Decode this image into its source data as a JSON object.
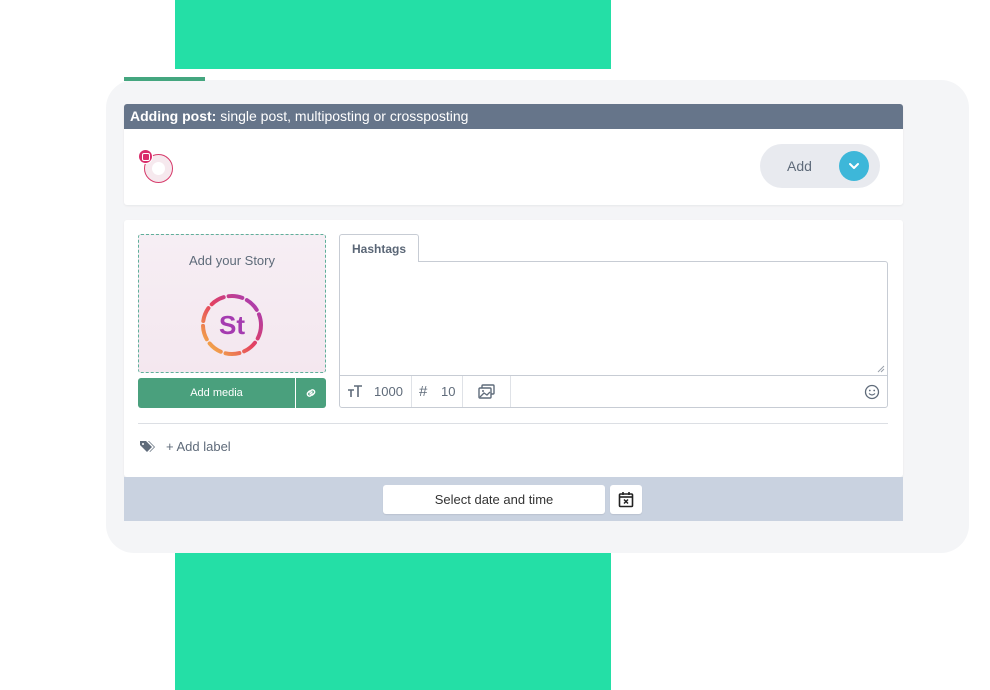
{
  "header": {
    "title_bold": "Adding post:",
    "title_rest": " single post, multiposting or crossposting"
  },
  "account": {
    "icon": "instagram-icon"
  },
  "add_button": {
    "label": "Add"
  },
  "story": {
    "label": "Add your Story",
    "logo_text": "St"
  },
  "media": {
    "add_media_label": "Add media",
    "link_icon": "link-icon"
  },
  "editor": {
    "tab_label": "Hashtags",
    "char_limit": "1000",
    "hashtag_limit": "10"
  },
  "labels": {
    "add_label": "+ Add label"
  },
  "schedule": {
    "select_date_label": "Select date and time"
  },
  "colors": {
    "accent_green": "#24dfa6",
    "button_green": "#4aa07d",
    "header_slate": "#66758a",
    "chevron_blue": "#3db7d9",
    "instagram_pink": "#d92c6a"
  }
}
